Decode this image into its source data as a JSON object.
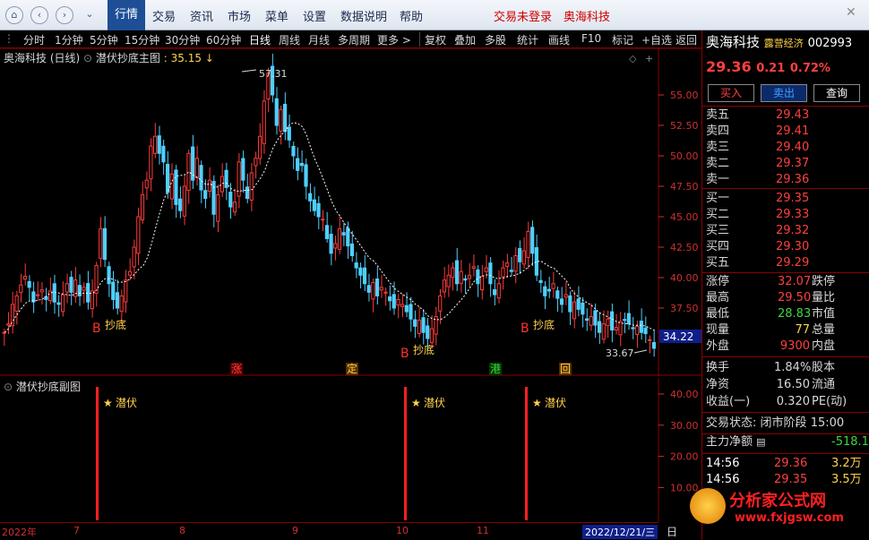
{
  "menu": {
    "items": [
      "行情",
      "交易",
      "资讯",
      "市场",
      "菜单",
      "设置",
      "数据说明",
      "帮助"
    ],
    "active": "行情",
    "login": "交易未登录",
    "stock_tab": "奥海科技"
  },
  "toolbar": {
    "periods": [
      "分时",
      "1分钟",
      "5分钟",
      "15分钟",
      "30分钟",
      "60分钟",
      "日线",
      "周线",
      "月线",
      "多周期",
      "更多 >"
    ],
    "selected": "日线",
    "tools": [
      "复权",
      "叠加",
      "多股",
      "统计",
      "画线",
      "F10",
      "标记",
      "+自选",
      "返回"
    ]
  },
  "chart": {
    "title": "奥海科技 (日线)",
    "indicator": "潜伏抄底主图",
    "indicator_value": ": 35.15",
    "high_label": "57.31",
    "low_label": "33.67",
    "current_price_tag": "34.22",
    "signals": [
      "B",
      "抄底"
    ],
    "events": [
      "涨",
      "定",
      "港",
      "回"
    ],
    "y_ticks": [
      "55.00",
      "52.50",
      "50.00",
      "47.50",
      "45.00",
      "42.50",
      "40.00",
      "37.50"
    ],
    "sub_title": "潜伏抄底副图",
    "sub_label": "潜伏",
    "sub_ticks": [
      "40.00",
      "30.00",
      "20.00",
      "10.00"
    ],
    "dates": [
      "2022年",
      "7",
      "8",
      "9",
      "10",
      "11"
    ],
    "current_date": "2022/12/21/三",
    "corner": "日"
  },
  "chart_data": {
    "type": "candlestick",
    "title": "奥海科技 (日线)",
    "ylim": [
      35.0,
      57.31
    ],
    "series": [
      {
        "name": "潜伏抄底主图",
        "values": [
          35.15
        ]
      }
    ],
    "price_high": 57.31,
    "price_low": 33.67,
    "last_price": 34.22,
    "sub_indicator": "潜伏抄底副图",
    "sub_ylim": [
      0,
      40
    ]
  },
  "quote": {
    "name": "奥海科技",
    "tag": "露营经济",
    "code": "002993",
    "price": "29.36",
    "change": "0.21",
    "change_pct": "0.72%",
    "buy_btn": "买入",
    "sell_btn": "卖出",
    "query_btn": "查询",
    "asks": [
      {
        "label": "卖五",
        "price": "29.43"
      },
      {
        "label": "卖四",
        "price": "29.41"
      },
      {
        "label": "卖三",
        "price": "29.40"
      },
      {
        "label": "卖二",
        "price": "29.37"
      },
      {
        "label": "卖一",
        "price": "29.36"
      }
    ],
    "bids": [
      {
        "label": "买一",
        "price": "29.35"
      },
      {
        "label": "买二",
        "price": "29.33"
      },
      {
        "label": "买三",
        "price": "29.32"
      },
      {
        "label": "买四",
        "price": "29.30"
      },
      {
        "label": "买五",
        "price": "29.29"
      }
    ],
    "stats": [
      {
        "l1": "涨停",
        "v1": "32.07",
        "l2": "跌停"
      },
      {
        "l1": "最高",
        "v1": "29.50",
        "l2": "量比"
      },
      {
        "l1": "最低",
        "v1": "28.83",
        "l2": "市值"
      },
      {
        "l1": "现量",
        "v1": "77",
        "l2": "总量"
      },
      {
        "l1": "外盘",
        "v1": "9300",
        "l2": "内盘"
      }
    ],
    "extra": [
      {
        "l1": "换手",
        "v1": "1.84%",
        "l2": "股本"
      },
      {
        "l1": "净资",
        "v1": "16.50",
        "l2": "流通"
      },
      {
        "l1": "收益(一)",
        "v1": "0.320",
        "l2": "PE(动)"
      }
    ],
    "status_label": "交易状态:",
    "status_value": "闭市阶段",
    "status_time": "15:00",
    "net_label": "主力净额",
    "net_value": "-518.1",
    "ticks": [
      {
        "time": "14:56",
        "price": "29.36",
        "vol": "3.2万"
      },
      {
        "time": "14:56",
        "price": "29.35",
        "vol": "3.5万"
      }
    ],
    "watermark": "分析家公式网",
    "watermark_url": "www.fxjgsw.com"
  }
}
